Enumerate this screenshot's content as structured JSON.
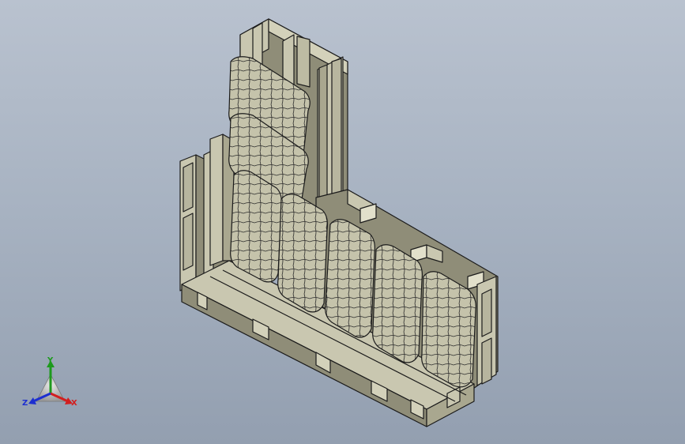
{
  "viewport": {
    "background_top": "#b9c2cf",
    "background_bottom": "#939fb0",
    "model_face_color": "#c9c7b0",
    "model_shade_color": "#8f8d78",
    "model_edge_color": "#1b1b1b",
    "model": "pallet-sofa-assembly"
  },
  "triad": {
    "x_label": "X",
    "y_label": "Y",
    "z_label": "Z",
    "x_color": "#d21f1f",
    "y_color": "#1d9a1d",
    "z_color": "#1d2fd0"
  }
}
